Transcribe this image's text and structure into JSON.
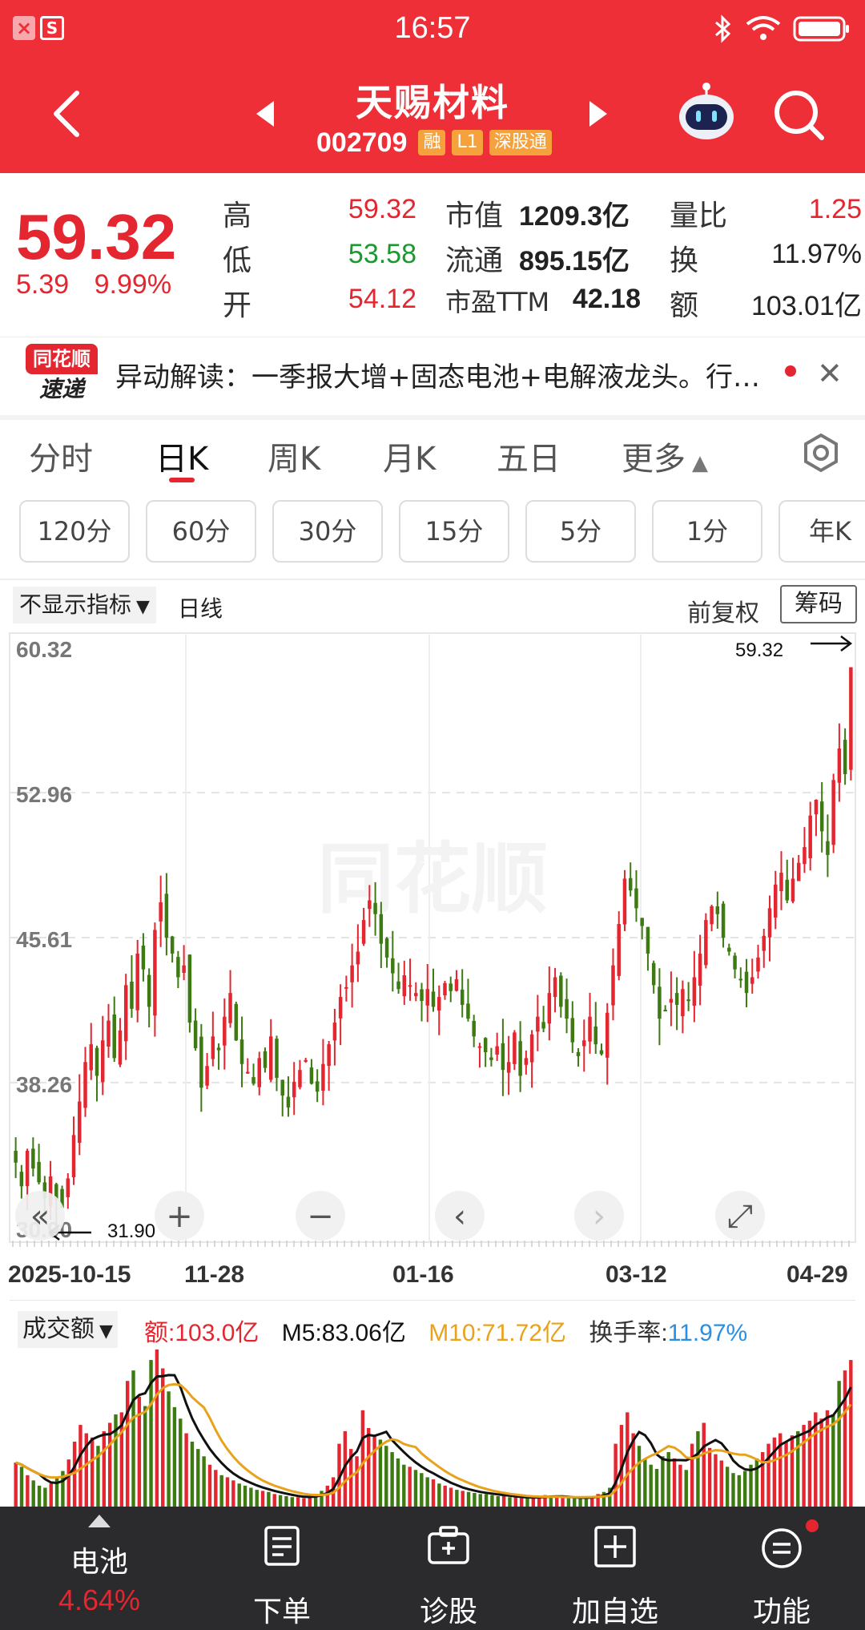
{
  "status_bar": {
    "time": "16:57",
    "left_icons": [
      "close-app-icon",
      "s-badge-icon"
    ],
    "right_icons": [
      "bluetooth-icon",
      "wifi-icon",
      "battery-icon"
    ]
  },
  "header": {
    "stock_name": "天赐材料",
    "stock_code": "002709",
    "tags": [
      "融",
      "L1",
      "深股通"
    ],
    "colors": {
      "background": "#ee2f38",
      "tag": "#f6a23c"
    }
  },
  "quote": {
    "price": "59.32",
    "change": "5.39",
    "change_pct": "9.99%",
    "rows": [
      [
        {
          "label": "高",
          "value": "59.32"
        },
        {
          "label": "市值",
          "value": "1209.3亿"
        },
        {
          "label": "量比",
          "value": "1.25"
        }
      ],
      [
        {
          "label": "低",
          "value": "53.58"
        },
        {
          "label": "流通",
          "value": "895.15亿"
        },
        {
          "label": "换",
          "value": "11.97%"
        }
      ],
      [
        {
          "label": "开",
          "value": "54.12"
        },
        {
          "label": "市盈TTM",
          "value": "42.18"
        },
        {
          "label": "额",
          "value": "103.01亿"
        }
      ]
    ],
    "colors": {
      "up": "#e3262f",
      "down": "#1a9a2e"
    }
  },
  "news": {
    "logo_top": "同花顺",
    "logo_bottom": "速递",
    "text": "异动解读：一季报大增+固态电池+电解液龙头。行…"
  },
  "tabs": {
    "items": [
      "分时",
      "日K",
      "周K",
      "月K",
      "五日",
      "更多"
    ],
    "active": "日K"
  },
  "periods": [
    "120分",
    "60分",
    "30分",
    "15分",
    "5分",
    "1分",
    "年K"
  ],
  "chart_controls": {
    "indicator": "不显示指标",
    "line_type": "日线",
    "adjust": "前复权",
    "chips": "筹码"
  },
  "chart_data": [
    {
      "type": "candlestick",
      "title": "",
      "y_ticks": [
        "60.32",
        "52.96",
        "45.61",
        "38.26",
        "30.90"
      ],
      "ylim": [
        30.9,
        60.32
      ],
      "x_ticks": [
        "2025-10-15",
        "11-28",
        "01-16",
        "03-12",
        "04-29"
      ],
      "annotations": {
        "max": "59.32",
        "min": "31.90"
      },
      "closes": [
        34.2,
        33.0,
        34.8,
        33.9,
        33.2,
        32.4,
        33.5,
        32.3,
        31.9,
        33.4,
        35.6,
        37.3,
        39.3,
        40.2,
        38.6,
        40.4,
        41.4,
        39.5,
        40.9,
        43.2,
        42.0,
        44.8,
        44.0,
        42.1,
        46.0,
        47.4,
        45.6,
        44.8,
        43.6,
        44.2,
        41.3,
        40.0,
        38.0,
        39.1,
        40.6,
        39.9,
        41.6,
        42.8,
        40.4,
        39.2,
        38.8,
        38.2,
        39.5,
        39.0,
        40.6,
        38.5,
        37.6,
        37.0,
        38.3,
        38.9,
        39.4,
        38.2,
        37.8,
        39.2,
        40.2,
        41.3,
        42.6,
        43.1,
        44.2,
        44.9,
        46.5,
        47.5,
        46.8,
        45.3,
        44.6,
        43.8,
        43.0,
        43.7,
        43.2,
        42.8,
        42.4,
        43.0,
        42.1,
        42.6,
        43.3,
        42.9,
        43.5,
        42.2,
        41.5,
        40.6,
        40.1,
        39.8,
        39.4,
        40.1,
        38.9,
        39.3,
        40.8,
        38.6,
        39.5,
        40.7,
        41.6,
        41.0,
        42.8,
        43.6,
        42.1,
        41.5,
        40.3,
        39.6,
        40.4,
        41.6,
        40.2,
        39.7,
        41.8,
        44.2,
        46.3,
        48.6,
        48.0,
        47.1,
        46.2,
        44.8,
        43.2,
        41.5,
        41.9,
        42.5,
        42.2,
        43.0,
        42.4,
        43.6,
        44.8,
        46.5,
        47.2,
        46.8,
        45.6,
        44.9,
        44.0,
        43.5,
        42.8,
        43.6,
        44.6,
        45.7,
        47.1,
        48.3,
        48.9,
        47.5,
        48.6,
        49.4,
        50.2,
        51.8,
        52.6,
        51.0,
        49.8,
        53.6,
        55.2,
        53.9,
        59.32
      ],
      "candle_colors": {
        "up": "#e3262f",
        "down": "#3d7a12"
      }
    },
    {
      "type": "bar",
      "title": "成交额",
      "series": [
        {
          "name": "额",
          "value": "103.0亿",
          "color": "#e3262f"
        },
        {
          "name": "M5",
          "value": "83.06亿",
          "color": "#111111"
        },
        {
          "name": "M10",
          "value": "71.72亿",
          "color": "#e8a21b"
        },
        {
          "name": "换手率",
          "value": "11.97%",
          "color": "#2a8fe0"
        }
      ],
      "values": [
        42,
        38,
        30,
        25,
        20,
        18,
        22,
        28,
        34,
        45,
        62,
        78,
        70,
        66,
        58,
        72,
        80,
        88,
        90,
        120,
        130,
        105,
        96,
        140,
        150,
        132,
        110,
        95,
        84,
        70,
        62,
        55,
        48,
        40,
        35,
        30,
        28,
        25,
        22,
        20,
        18,
        16,
        15,
        14,
        12,
        11,
        10,
        9,
        9,
        8,
        10,
        12,
        15,
        20,
        28,
        60,
        72,
        55,
        48,
        92,
        75,
        68,
        64,
        58,
        52,
        46,
        40,
        38,
        35,
        32,
        28,
        26,
        22,
        20,
        18,
        16,
        15,
        14,
        13,
        12,
        12,
        11,
        10,
        10,
        9,
        9,
        8,
        8,
        9,
        10,
        11,
        10,
        9,
        9,
        8,
        8,
        8,
        9,
        10,
        12,
        14,
        18,
        60,
        78,
        90,
        70,
        58,
        45,
        40,
        36,
        48,
        52,
        46,
        40,
        35,
        60,
        72,
        80,
        56,
        50,
        44,
        38,
        32,
        30,
        34,
        40,
        46,
        52,
        60,
        66,
        70,
        62,
        68,
        72,
        78,
        82,
        90,
        84,
        92,
        88,
        120,
        130,
        140
      ]
    }
  ],
  "bottom_bar": {
    "items": [
      {
        "label": "电池",
        "sub": "4.64%",
        "icon": "caret-up-icon"
      },
      {
        "label": "下单",
        "icon": "order-icon"
      },
      {
        "label": "诊股",
        "icon": "diagnose-icon"
      },
      {
        "label": "加自选",
        "icon": "add-watchlist-icon"
      },
      {
        "label": "功能",
        "icon": "menu-icon"
      }
    ],
    "colors": {
      "background": "#2b2b2e",
      "sub": "#e3262f"
    }
  },
  "chart_tools": [
    "collapse-left-icon",
    "zoom-in-icon",
    "zoom-out-icon",
    "prev-icon",
    "next-icon",
    "fullscreen-icon"
  ],
  "watermark": "同花顺"
}
